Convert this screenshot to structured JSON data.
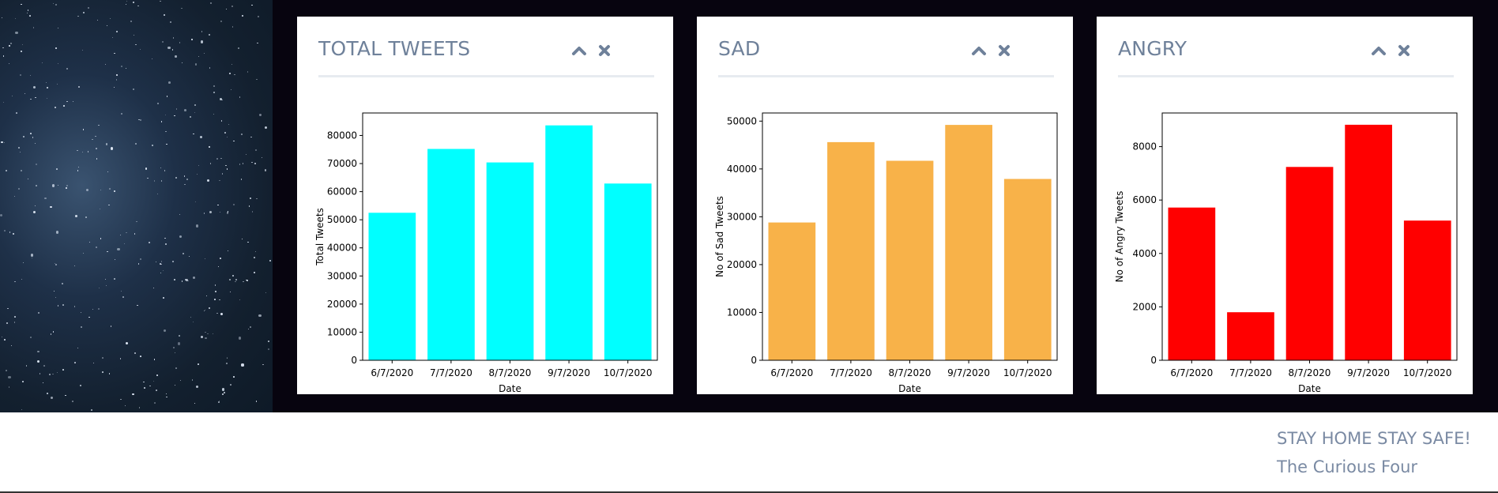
{
  "colors": {
    "total": "#00ffff",
    "sad": "#f8b249",
    "angry": "#ff0000",
    "title": "#6f819a",
    "footer": "#7a8aa3"
  },
  "panel_icons": {
    "collapse": "chevron-up-icon",
    "close": "close-icon"
  },
  "panels": [
    {
      "title": "TOTAL TWEETS"
    },
    {
      "title": "SAD"
    },
    {
      "title": "ANGRY"
    }
  ],
  "chart_data": [
    {
      "type": "bar",
      "title": "",
      "xlabel": "Date",
      "ylabel": "Total Tweets",
      "categories": [
        "6/7/2020",
        "7/7/2020",
        "8/7/2020",
        "9/7/2020",
        "10/7/2020"
      ],
      "values": [
        52500,
        75200,
        70400,
        83600,
        62900
      ],
      "ylim": [
        0,
        88000
      ],
      "yticks": [
        0,
        10000,
        20000,
        30000,
        40000,
        50000,
        60000,
        70000,
        80000
      ],
      "color": "#00ffff",
      "grid": false
    },
    {
      "type": "bar",
      "title": "",
      "xlabel": "Date",
      "ylabel": "No of Sad Tweets",
      "categories": [
        "6/7/2020",
        "7/7/2020",
        "8/7/2020",
        "9/7/2020",
        "10/7/2020"
      ],
      "values": [
        28800,
        45600,
        41700,
        49200,
        37900
      ],
      "ylim": [
        0,
        51700
      ],
      "yticks": [
        0,
        10000,
        20000,
        30000,
        40000,
        50000
      ],
      "color": "#f8b249",
      "grid": false
    },
    {
      "type": "bar",
      "title": "",
      "xlabel": "Date",
      "ylabel": "No of Angry Tweets",
      "categories": [
        "6/7/2020",
        "7/7/2020",
        "8/7/2020",
        "9/7/2020",
        "10/7/2020"
      ],
      "values": [
        5720,
        1800,
        7240,
        8820,
        5230
      ],
      "ylim": [
        0,
        9260
      ],
      "yticks": [
        0,
        2000,
        4000,
        6000,
        8000
      ],
      "color": "#ff0000",
      "grid": false
    }
  ],
  "footer": {
    "line1": "STAY HOME STAY SAFE!",
    "line2": "The Curious Four"
  }
}
